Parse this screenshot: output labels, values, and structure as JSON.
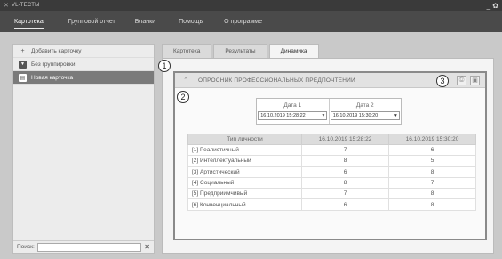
{
  "window": {
    "title": "VL-ТЕСТЫ",
    "controls": "_ ✿"
  },
  "menu": [
    "Картотека",
    "Групповой отчет",
    "Бланки",
    "Помощь",
    "О программе"
  ],
  "sidebar": {
    "add_label": "Добавить карточку",
    "group_label": "Без группировки",
    "card_label": "Новая карточка",
    "search_label": "Поиск:",
    "search_value": ""
  },
  "tabs": [
    "Картотека",
    "Результаты",
    "Динамика"
  ],
  "panel": {
    "title": "ОПРОСНИК ПРОФЕССИОНАЛЬНЫХ ПРЕДПОЧТЕНИЙ",
    "date1_label": "Дата 1",
    "date2_label": "Дата 2",
    "date1_value": "16.10.2019 15:28:22",
    "date2_value": "16.10.2019 15:30:20"
  },
  "table": {
    "headers": [
      "Тип личности",
      "16.10.2019 15:28:22",
      "16.10.2019 15:30:20"
    ],
    "rows": [
      [
        "[1] Реалистичный",
        "7",
        "6"
      ],
      [
        "[2] Интеллектуальный",
        "8",
        "5"
      ],
      [
        "[3] Артистический",
        "6",
        "8"
      ],
      [
        "[4] Социальный",
        "8",
        "7"
      ],
      [
        "[5] Предприимчивый",
        "7",
        "8"
      ],
      [
        "[6] Конвенциальный",
        "6",
        "8"
      ]
    ]
  },
  "callouts": [
    "1",
    "2",
    "3"
  ]
}
